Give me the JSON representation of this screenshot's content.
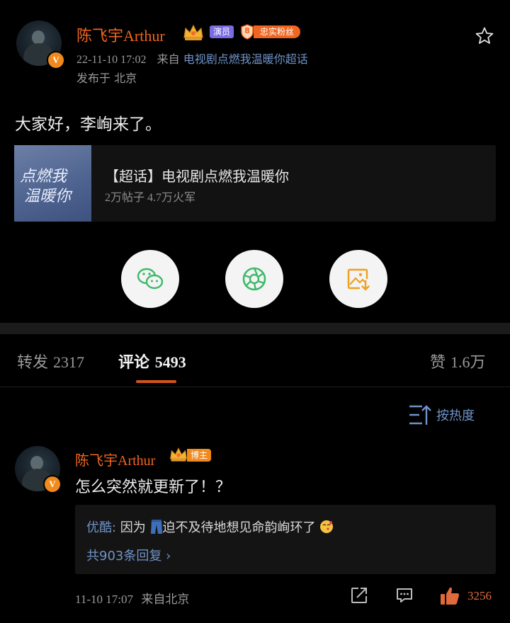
{
  "post": {
    "author": "陈飞宇Arthur",
    "verified_badge": "V",
    "tag_actor": "演员",
    "tag_fan_level": "8",
    "tag_fan": "忠实粉丝",
    "time": "22-11-10 17:02",
    "from_label": "来自",
    "source": "电视剧点燃我温暖你超话",
    "location": "发布于 北京",
    "text": "大家好，李峋来了。",
    "favorite_icon": "star-outline-icon"
  },
  "topic": {
    "cover_line1": "点燃我",
    "cover_line2": "温暖你",
    "title": "【超话】电视剧点燃我温暖你",
    "stats": "2万帖子 4.7万火军"
  },
  "share": {
    "icons": [
      "wechat-icon",
      "moments-icon",
      "save-image-icon"
    ]
  },
  "tabs": {
    "repost_label": "转发",
    "repost_count": "2317",
    "comment_label": "评论",
    "comment_count": "5493",
    "like_label": "赞",
    "like_count": "1.6万"
  },
  "sort": {
    "label": "按热度"
  },
  "comment": {
    "author": "陈飞宇Arthur",
    "badge": "博主",
    "text": "怎么突然就更新了！？",
    "reply_user": "优酷:",
    "reply_text_before": " 因为",
    "reply_emoji": "jeans-emoji",
    "reply_text_after": "迫不及待地想见命韵峋环了",
    "reply_more": "共903条回复 ›",
    "time": "11-10 17:07",
    "location": "来自北京",
    "likes": "3256"
  },
  "colors": {
    "accent_orange": "#f0651f",
    "link_blue": "#6f93c9",
    "background": "#000000"
  }
}
